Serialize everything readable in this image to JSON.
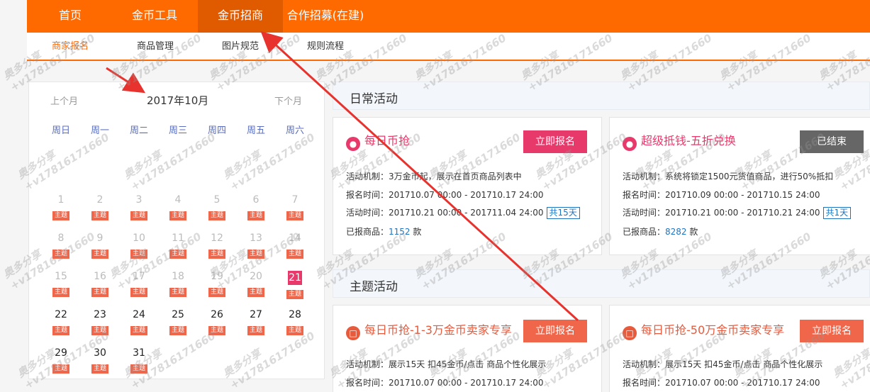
{
  "topnav": {
    "items": [
      {
        "label": "首页"
      },
      {
        "label": "金币工具"
      },
      {
        "label": "金币招商"
      },
      {
        "label": "合作招募(在建)"
      }
    ]
  },
  "subnav": {
    "items": [
      {
        "label": "商家报名"
      },
      {
        "label": "商品管理"
      },
      {
        "label": "图片规范"
      },
      {
        "label": "规则流程"
      }
    ]
  },
  "calendar": {
    "prev": "上个月",
    "title": "2017年10月",
    "next": "下个月",
    "weekdays": [
      "周日",
      "周一",
      "周二",
      "周三",
      "周四",
      "周五",
      "周六"
    ],
    "tag": "主题",
    "days": [
      "1",
      "2",
      "3",
      "4",
      "5",
      "6",
      "7",
      "8",
      "9",
      "10",
      "11",
      "12",
      "13",
      "14",
      "15",
      "16",
      "17",
      "18",
      "19",
      "20",
      "21",
      "22",
      "23",
      "24",
      "25",
      "26",
      "27",
      "28",
      "29",
      "30",
      "31"
    ],
    "today": "21"
  },
  "daily": {
    "heading": "日常活动",
    "cards": [
      {
        "icon": "user-icon",
        "title": "每日币抢",
        "button": "立即报名",
        "mechanism": "活动机制：3万金币起，展示在首页商品列表中",
        "signup_time": "报名时间：201710.07 00:00 - 201710.17 24:00",
        "active_time": "活动时间：201710.21 00:00 - 201711.04 24:00",
        "days": "共15天",
        "registered_label": "已报商品：",
        "registered_count": "1152",
        "unit": "款"
      },
      {
        "icon": "user-icon",
        "title": "超级抵钱-五折兑换",
        "button": "已结束",
        "mechanism": "活动机制：系统将锁定1500元货值商品，进行50%抵扣",
        "signup_time": "报名时间：201710.09 00:00 - 201710.15 24:00",
        "active_time": "活动时间：201710.21 00:00 - 201710.21 24:00",
        "days": "共1天",
        "registered_label": "已报商品：",
        "registered_count": "8282",
        "unit": "款"
      }
    ]
  },
  "theme": {
    "heading": "主题活动",
    "cards": [
      {
        "icon": "bookmark-icon",
        "title": "每日币抢-1-3万金币卖家专享",
        "button": "立即报名",
        "mechanism": "活动机制：展示15天 扣45金币/点击 商品个性化展示",
        "signup_time": "报名时间：201710.07 00:00 - 201710.17 24:00"
      },
      {
        "icon": "bookmark-icon",
        "title": "每日币抢-50万金币卖家专享",
        "button": "立即报名",
        "mechanism": "活动机制：展示15天 扣45金币/点击 商品个性化展示",
        "signup_time": "报名时间：201710.07 00:00 - 201710.17 24:00"
      }
    ]
  },
  "watermark": {
    "line1": "奥多分享",
    "line2": "+v17816171660"
  },
  "colors": {
    "brand_orange": "#ff6a00",
    "accent_pink": "#e8396b",
    "tag_orange": "#f0664a",
    "link_blue": "#1f74c2"
  }
}
